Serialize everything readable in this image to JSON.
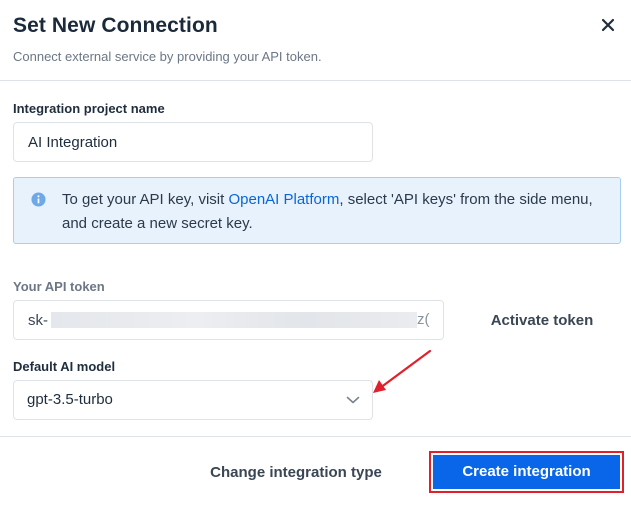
{
  "dialog": {
    "title": "Set New Connection",
    "subtitle": "Connect external service by providing your API token."
  },
  "project": {
    "label": "Integration project name",
    "value": "AI Integration"
  },
  "info": {
    "text_before": "To get your API key, visit ",
    "link_text": "OpenAI Platform",
    "text_after": ", select 'API keys' from the side menu, and create a new secret key."
  },
  "token": {
    "label": "Your API token",
    "value_prefix": "sk-",
    "value_suffix": "z(",
    "activate_label": "Activate token"
  },
  "model": {
    "label": "Default AI model",
    "selected": "gpt-3.5-turbo"
  },
  "footer": {
    "change_label": "Change integration type",
    "create_label": "Create integration"
  },
  "colors": {
    "primary": "#0a66e8",
    "link": "#0a66d8",
    "highlight": "#e1202b",
    "info_bg": "#e8f2fd"
  },
  "icons": {
    "close": "close-icon",
    "info": "info-icon",
    "chevron": "chevron-down-icon",
    "annotation": "red-arrow-annotation"
  }
}
